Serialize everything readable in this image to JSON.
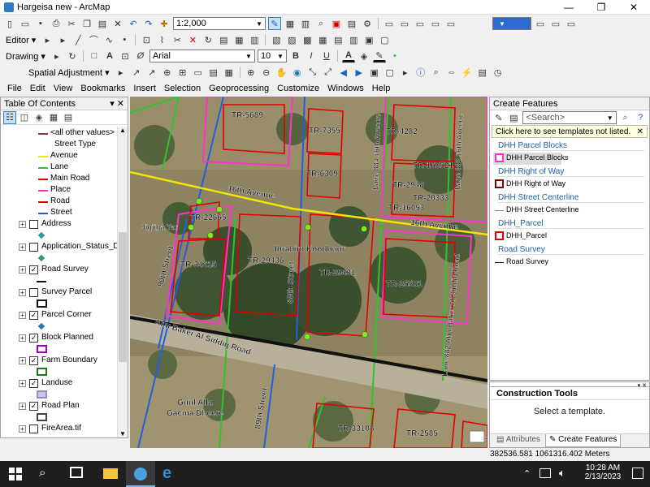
{
  "window": {
    "title": "Hargeisa new - ArcMap",
    "minimize": "—",
    "maximize": "❐",
    "close": "✕"
  },
  "standard_toolbar": {
    "scale": "1:2,000"
  },
  "editor_toolbar": {
    "label": "Editor ▾"
  },
  "draw_toolbar": {
    "label": "Drawing ▾",
    "font": "Arial",
    "font_size": "10",
    "bold": "B",
    "italic": "I",
    "underline": "U"
  },
  "spatial_toolbar": {
    "label": "Spatial Adjustment ▾"
  },
  "menubar": {
    "items": [
      "File",
      "Edit",
      "View",
      "Bookmarks",
      "Insert",
      "Selection",
      "Geoprocessing",
      "Customize",
      "Windows",
      "Help"
    ]
  },
  "toc": {
    "title": "Table Of Contents",
    "pin": "▾ ✕",
    "items": [
      {
        "name": "<all other values>",
        "kind": "legend",
        "color": "#8b3a3a"
      },
      {
        "name": "Street Type",
        "kind": "header"
      },
      {
        "name": "Avenue",
        "kind": "legend",
        "color": "#f2e600"
      },
      {
        "name": "Lane",
        "kind": "legend",
        "color": "#2fc42f"
      },
      {
        "name": "Main Road",
        "kind": "legend",
        "color": "#e00000"
      },
      {
        "name": "Place",
        "kind": "legend",
        "color": "#ff33cc"
      },
      {
        "name": "Road",
        "kind": "legend",
        "color": "#e00000"
      },
      {
        "name": "Street",
        "kind": "legend",
        "color": "#2060e0"
      },
      {
        "name": "Address",
        "kind": "layer",
        "checked": false
      },
      {
        "name": "",
        "kind": "point",
        "color": "#2a9aa0"
      },
      {
        "name": "Application_Status_DH",
        "kind": "layer",
        "checked": false
      },
      {
        "name": "",
        "kind": "point",
        "color": "#2a9a7a"
      },
      {
        "name": "Road Survey",
        "kind": "layer",
        "checked": true
      },
      {
        "name": "",
        "kind": "line",
        "color": "#111111"
      },
      {
        "name": "Survey Parcel",
        "kind": "layer",
        "checked": false
      },
      {
        "name": "",
        "kind": "poly",
        "color": "#111111",
        "fill": "#ffffff"
      },
      {
        "name": "Parcel Corner",
        "kind": "layer",
        "checked": true
      },
      {
        "name": "",
        "kind": "point",
        "color": "#2a7ab0"
      },
      {
        "name": "Block Planned",
        "kind": "layer",
        "checked": true
      },
      {
        "name": "",
        "kind": "poly",
        "color": "#a000c0",
        "fill": "#ffffff"
      },
      {
        "name": "Farm Boundary",
        "kind": "layer",
        "checked": true
      },
      {
        "name": "",
        "kind": "poly",
        "color": "#1a7a1a",
        "fill": "#ffffff"
      },
      {
        "name": "Landuse",
        "kind": "layer",
        "checked": true
      },
      {
        "name": "",
        "kind": "poly",
        "color": "#9090c0",
        "fill": "#c8c8ee"
      },
      {
        "name": "Road Plan",
        "kind": "layer",
        "checked": true
      },
      {
        "name": "",
        "kind": "poly",
        "color": "#444444",
        "fill": "#ffffff"
      },
      {
        "name": "FireArea.tif",
        "kind": "layer",
        "checked": false
      }
    ]
  },
  "map": {
    "labels": [
      "TR-5689",
      "TR-7355",
      "TR-4282",
      "TR-160521",
      "TR-6309",
      "TR-2948",
      "TR-20333",
      "TR-16053",
      "16th Avenue",
      "16th Avenue",
      "TR-22665",
      "Jigjiga Yar",
      "Ibrahim Koodbuur",
      "TR-29436",
      "TR-29431",
      "TR-34615",
      "TR-25501",
      "90th Street",
      "89th Street",
      "Lane 884 16th Avenue",
      "Lane 882 16th Avenue",
      "Abu Baker Al Siddiq Road",
      "Lane 882 Abu Baker Al Siddiq Road",
      "Guul Alla",
      "Gacma Dheere",
      "89th Street",
      "TR-33108",
      "TR-2585",
      "TR-2"
    ]
  },
  "create_features": {
    "title": "Create Features",
    "search_placeholder": "<Search>",
    "notice": "Click here to see templates not listed.",
    "groups": [
      {
        "header": "DHH Parcel Blocks",
        "item": "DHH Parcel Blocks",
        "kind": "poly",
        "color": "#ff33cc",
        "selected": true
      },
      {
        "header": "DHH Right of Way",
        "item": "DHH Right of Way",
        "kind": "poly",
        "color": "#800000",
        "selected": false
      },
      {
        "header": "DHH Street Centerline",
        "item": "DHH Street Centerline",
        "kind": "line",
        "color": "#888888",
        "selected": false
      },
      {
        "header": "DHH_Parcel",
        "item": "DHH_Parcel",
        "kind": "poly",
        "color": "#e00000",
        "selected": false
      },
      {
        "header": "Road Survey",
        "item": "Road Survey",
        "kind": "line",
        "color": "#111111",
        "selected": false
      }
    ]
  },
  "construction_tools": {
    "title": "Construction Tools",
    "hint": "Select a template.",
    "tab_attributes": "Attributes",
    "tab_create": "Create Features"
  },
  "statusbar": {
    "coords": "382536.581  1061316.402 Meters"
  },
  "taskbar": {
    "time": "10:28 AM",
    "date": "2/13/2023"
  }
}
